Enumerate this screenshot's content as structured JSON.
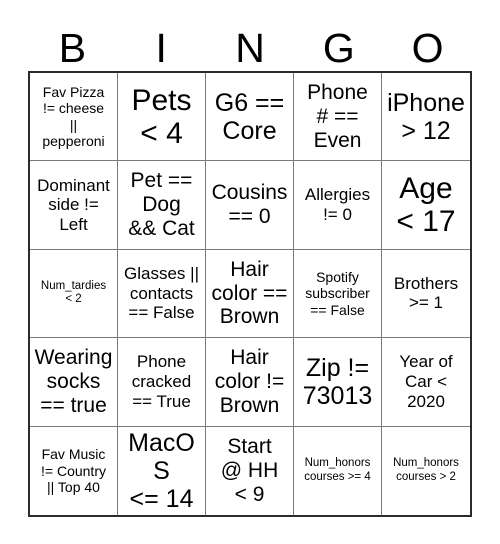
{
  "title": "BINGO",
  "header": {
    "letters": [
      "B",
      "I",
      "N",
      "G",
      "O"
    ]
  },
  "grid": {
    "rows": 5,
    "columns": 5,
    "border_color": "#2b2b2b",
    "gridline_color": "#7a7a7a",
    "background_color": "#ffffff",
    "text_color": "#000000",
    "cells": [
      {
        "text": "Fav Pizza\n!= cheese\n||\npepperoni",
        "size": "sm"
      },
      {
        "text": "Pets\n< 4",
        "size": "xxl"
      },
      {
        "text": "G6 ==\nCore",
        "size": "xl"
      },
      {
        "text": "Phone\n# ==\nEven",
        "size": "lg"
      },
      {
        "text": "iPhone\n> 12",
        "size": "xl"
      },
      {
        "text": "Dominant\nside !=\nLeft",
        "size": "md"
      },
      {
        "text": "Pet ==\nDog\n&& Cat",
        "size": "lg"
      },
      {
        "text": "Cousins\n== 0",
        "size": "lg"
      },
      {
        "text": "Allergies\n!= 0",
        "size": "md"
      },
      {
        "text": "Age\n< 17",
        "size": "xxl"
      },
      {
        "text": "Num_tardies\n< 2",
        "size": "xs"
      },
      {
        "text": "Glasses ||\ncontacts\n== False",
        "size": "md"
      },
      {
        "text": "Hair\ncolor ==\nBrown",
        "size": "lg"
      },
      {
        "text": "Spotify\nsubscriber\n== False",
        "size": "sm"
      },
      {
        "text": "Brothers\n>= 1",
        "size": "md"
      },
      {
        "text": "Wearing\nsocks\n== true",
        "size": "lg"
      },
      {
        "text": "Phone\ncracked\n== True",
        "size": "md"
      },
      {
        "text": "Hair\ncolor !=\nBrown",
        "size": "lg"
      },
      {
        "text": "Zip !=\n73013",
        "size": "xl"
      },
      {
        "text": "Year of\nCar <\n2020",
        "size": "md"
      },
      {
        "text": "Fav Music\n!= Country\n|| Top 40",
        "size": "sm"
      },
      {
        "text": "MacOS\n<= 14",
        "size": "xl"
      },
      {
        "text": "Start\n@ HH\n< 9",
        "size": "lg"
      },
      {
        "text": "Num_honors\ncourses >= 4",
        "size": "xs"
      },
      {
        "text": "Num_honors\ncourses > 2",
        "size": "xs"
      }
    ]
  }
}
